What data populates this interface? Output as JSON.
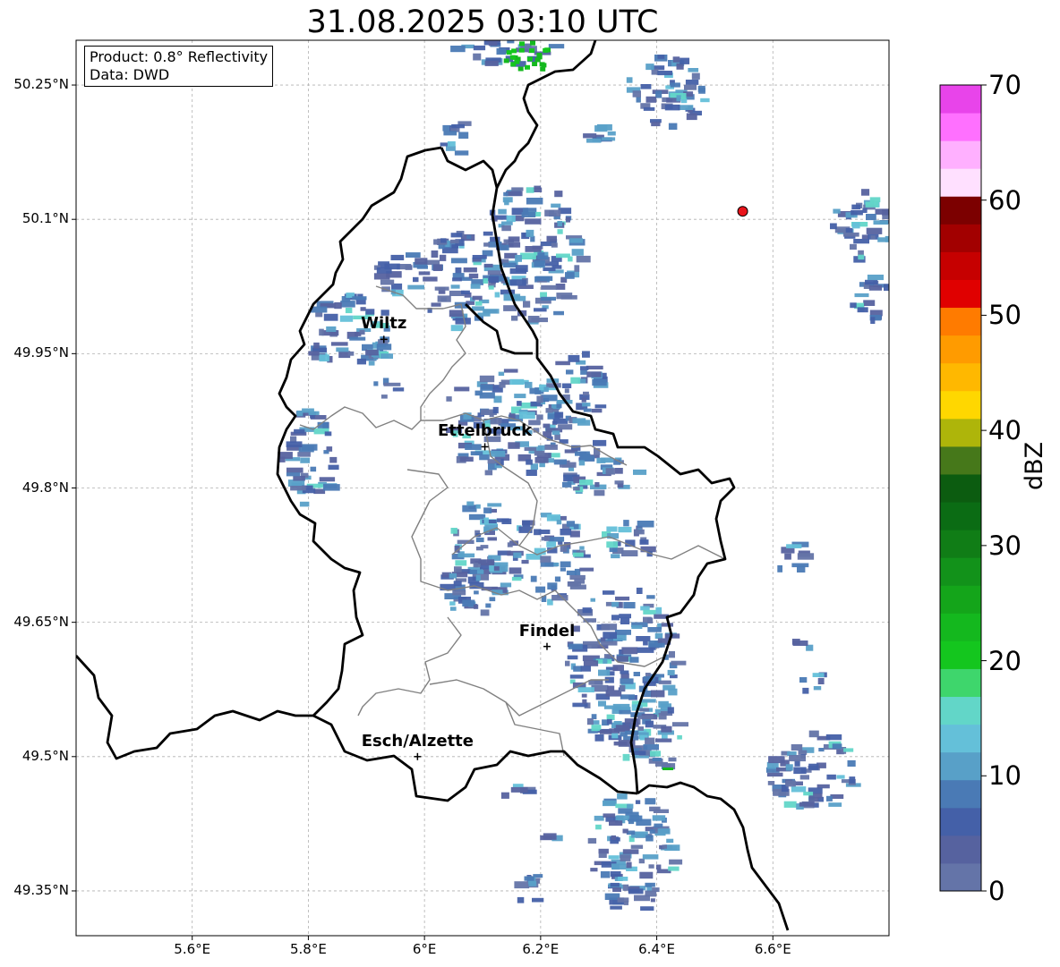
{
  "title": "31.08.2025 03:10 UTC",
  "info_box": {
    "product": "Product: 0.8° Reflectivity",
    "source": "Data: DWD"
  },
  "map": {
    "lon_range": [
      5.4,
      6.8
    ],
    "lat_range": [
      49.3,
      50.3
    ],
    "lat_ticks": [
      {
        "value": 50.25,
        "label": "50.25°N"
      },
      {
        "value": 50.1,
        "label": "50.1°N"
      },
      {
        "value": 49.95,
        "label": "49.95°N"
      },
      {
        "value": 49.8,
        "label": "49.8°N"
      },
      {
        "value": 49.65,
        "label": "49.65°N"
      },
      {
        "value": 49.5,
        "label": "49.5°N"
      },
      {
        "value": 49.35,
        "label": "49.35°N"
      }
    ],
    "lon_ticks": [
      {
        "value": 5.6,
        "label": "5.6°E"
      },
      {
        "value": 5.8,
        "label": "5.8°E"
      },
      {
        "value": 6.0,
        "label": "6°E"
      },
      {
        "value": 6.2,
        "label": "6.2°E"
      },
      {
        "value": 6.4,
        "label": "6.4°E"
      },
      {
        "value": 6.6,
        "label": "6.6°E"
      }
    ],
    "cities": [
      {
        "name": "Wiltz",
        "lon": 5.93,
        "lat": 49.966
      },
      {
        "name": "Ettelbruck",
        "lon": 6.104,
        "lat": 49.846
      },
      {
        "name": "Findel",
        "lon": 6.211,
        "lat": 49.623
      },
      {
        "name": "Esch/Alzette",
        "lon": 5.988,
        "lat": 49.5
      }
    ],
    "radar_site": {
      "lon": 6.548,
      "lat": 50.109,
      "color": "#e8141b"
    },
    "border_color": "#000000",
    "canton_color": "#808080"
  },
  "colorbar": {
    "label": "dBZ",
    "min": 0,
    "max": 70,
    "ticks": [
      {
        "value": 0,
        "label": "0"
      },
      {
        "value": 10,
        "label": "10"
      },
      {
        "value": 20,
        "label": "20"
      },
      {
        "value": 30,
        "label": "30"
      },
      {
        "value": 40,
        "label": "40"
      },
      {
        "value": 50,
        "label": "50"
      },
      {
        "value": 60,
        "label": "60"
      },
      {
        "value": 70,
        "label": "70"
      }
    ],
    "colors": [
      "#6474a8",
      "#56629f",
      "#4460a8",
      "#4a7ab5",
      "#58a0c8",
      "#64c0d9",
      "#62d6c8",
      "#3ed66c",
      "#14c61e",
      "#14b81e",
      "#14a51a",
      "#12921a",
      "#107d16",
      "#0b6c14",
      "#0c5c10",
      "#46781a",
      "#aeb50a",
      "#ffd700",
      "#ffb800",
      "#ff9b00",
      "#ff7b00",
      "#e00000",
      "#c60000",
      "#a20000",
      "#7c0000",
      "#ffe0ff",
      "#ffb0ff",
      "#ff70ff",
      "#e844ea"
    ]
  }
}
